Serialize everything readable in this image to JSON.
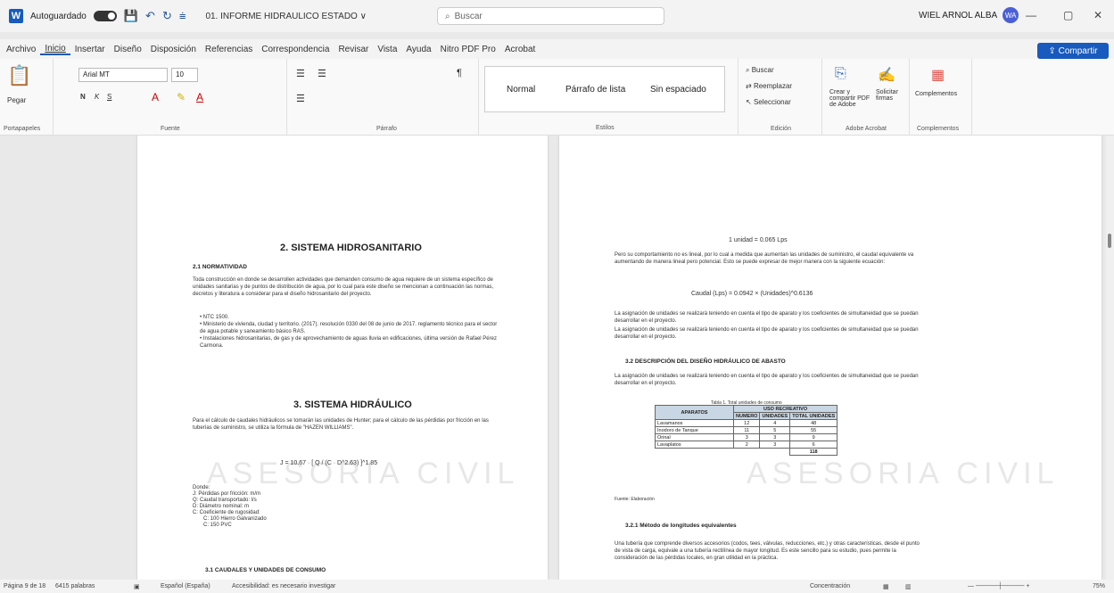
{
  "titlebar": {
    "autosave_label": "Autoguardado",
    "doc_title": "01. INFORME HIDRAULICO ESTADO ∨",
    "search_placeholder": "Buscar",
    "user_name": "WIEL ARNOL ALBA",
    "user_initials": "WA"
  },
  "menu": [
    "Archivo",
    "Inicio",
    "Insertar",
    "Diseño",
    "Disposición",
    "Referencias",
    "Correspondencia",
    "Revisar",
    "Vista",
    "Ayuda",
    "Nitro PDF Pro",
    "Acrobat"
  ],
  "share_label": "Compartir",
  "ribbon": {
    "paste": "Pegar",
    "clipboard": "Portapapeles",
    "font_name": "Arial MT",
    "font_size": "10",
    "font_group": "Fuente",
    "paragraph_group": "Párrafo",
    "styles": [
      "Normal",
      "Párrafo de lista",
      "Sin espaciado"
    ],
    "styles_group": "Estilos",
    "find": "Buscar",
    "replace": "Reemplazar",
    "select": "Seleccionar",
    "edit_group": "Edición",
    "create_pdf": "Crear y compartir PDF de Adobe",
    "request_sign": "Solicitar firmas",
    "adobe_group": "Adobe Acrobat",
    "addins": "Complementos",
    "addins_group": "Complementos"
  },
  "page_left": {
    "h_sanitario": "2. SISTEMA HIDROSANITARIO",
    "h_normatividad": "2.1 NORMATIVIDAD",
    "p_intro": "Toda construcción en donde se desarrollen actividades que demanden consumo de agua requiere de un sistema específico de unidades sanitarias y de puntos de distribución de agua, por lo cual para este diseño se mencionan a continuación las normas, decretos y literatura a considerar para el diseño hidrosanitario del proyecto.",
    "bullets": [
      "NTC 1500.",
      "Ministerio de vivienda, ciudad y territorio. (2017). resolución 0330 del 08 de junio de 2017. reglamento técnico para el sector de agua potable y saneamiento básico RAS.",
      "Instalaciones hidrosanitarias, de gas y de aprovechamiento de aguas lluvia en edificaciones, última versión de Rafael Pérez Carmona."
    ],
    "h_hidraulico": "3. SISTEMA HIDRÁULICO",
    "p_hazen": "Para el cálculo de caudales hidráulicos se tomarán las unidades de Hunter; para el cálculo de las pérdidas por fricción en las tuberías de suministro, se utiliza la fórmula de \"HAZEN WILLIAMS\".",
    "formula": "J = 10.67 · [ Q / (C · D^2.63) ]^1.85",
    "donde": [
      "Donde:",
      "J: Pérdidas por fricción: m/m",
      "Q: Caudal transportado: l/s",
      "D: Diámetro nominal: m",
      "C: Coeficiente de rugosidad:",
      "C: 100 Hierro Galvanizado",
      "C: 150 PVC"
    ],
    "h_caudales": "3.1 CAUDALES Y UNIDADES DE CONSUMO",
    "watermark": "ASESORIA CIVIL"
  },
  "page_right": {
    "unit": "1 unidad = 0.065 Lps",
    "p1": "Pero su comportamiento no es lineal, por lo cual a medida que aumentan las unidades de suministro, el caudal equivalente va aumentando de manera lineal pero potencial. Esto se puede expresar de mejor manera con la siguiente ecuación:",
    "formula": "Caudal (Lps) = 0.0942 × (Unidades)^0.6136",
    "p2": "La asignación de unidades se realizará teniendo en cuenta el tipo de aparato y los coeficientes de simultaneidad que se puedan desarrollar en el proyecto.",
    "p3": "La asignación de unidades se realizará teniendo en cuenta el tipo de aparato y los coeficientes de simultaneidad que se puedan desarrollar en el proyecto.",
    "h_abasto": "3.2 DESCRIPCIÓN DEL DISEÑO HIDRÁULICO DE ABASTO",
    "p4": "La asignación de unidades se realizará teniendo en cuenta el tipo de aparato y los coeficientes de simultaneidad que se puedan desarrollar en el proyecto.",
    "table_caption": "Tabla 1. Total unidades de consumo",
    "table": {
      "col_aparatos": "APARATOS",
      "col_group": "USO RECREATIVO",
      "col_numero": "NUMERO",
      "col_unidades": "UNIDADES",
      "col_total": "TOTAL UNIDADES",
      "rows": [
        [
          "Lavamanos",
          "12",
          "4",
          "48"
        ],
        [
          "Inodoro de Tanque",
          "11",
          "5",
          "55"
        ],
        [
          "Orinal",
          "3",
          "3",
          "9"
        ],
        [
          "Lavaplatos",
          "2",
          "3",
          "6"
        ]
      ],
      "grand_total": "118"
    },
    "fuente": "Fuente: Elaboración",
    "h_metodo": "3.2.1 Método de longitudes equivalentes",
    "p5": "Una tubería que comprende diversos accesorios (codos, tees, válvulas, reducciones, etc.) y otras características, desde el punto de vista de carga, equivale a una tubería rectilínea de mayor longitud. Es este sencillo para su estudio, pues permite la consideración de las pérdidas locales, en gran utilidad en la práctica.",
    "watermark": "ASESORIA CIVIL"
  },
  "status": {
    "page": "Página 9 de 18",
    "words": "6415 palabras",
    "lang": "Español (España)",
    "access": "Accesibilidad: es necesario investigar",
    "focus": "Concentración",
    "zoom": "75%"
  }
}
